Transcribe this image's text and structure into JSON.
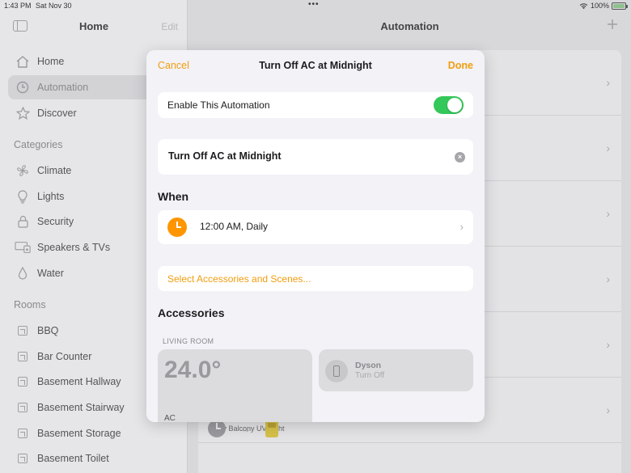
{
  "status_bar": {
    "time": "1:43 PM",
    "date": "Sat Nov 30",
    "dots": "•••",
    "battery": "100%",
    "battery_level": 1.0
  },
  "sidebar": {
    "title": "Home",
    "edit_label": "Edit",
    "nav": [
      {
        "label": "Home",
        "icon": "house-icon"
      },
      {
        "label": "Automation",
        "icon": "clock-icon"
      },
      {
        "label": "Discover",
        "icon": "star-icon"
      }
    ],
    "categories_header": "Categories",
    "categories": [
      {
        "label": "Climate",
        "icon": "fan-icon"
      },
      {
        "label": "Lights",
        "icon": "lightbulb-icon"
      },
      {
        "label": "Security",
        "icon": "lock-icon"
      },
      {
        "label": "Speakers & TVs",
        "icon": "tv-icon"
      },
      {
        "label": "Water",
        "icon": "drop-icon"
      }
    ],
    "rooms_header": "Rooms",
    "rooms": [
      "BBQ",
      "Bar Counter",
      "Basement Hallway",
      "Basement Stairway",
      "Basement Storage",
      "Basement Toilet"
    ]
  },
  "main": {
    "title": "Automation",
    "partial_label": "Study Balcony UV Light"
  },
  "modal": {
    "cancel_label": "Cancel",
    "title": "Turn Off AC at Midnight",
    "done_label": "Done",
    "enable_label": "Enable This Automation",
    "enabled": true,
    "name_value": "Turn Off AC at Midnight",
    "when_header": "When",
    "trigger": "12:00 AM, Daily",
    "select_label": "Select Accessories and Scenes...",
    "accessories_header": "Accessories",
    "room_label": "LIVING ROOM",
    "ac_tile": {
      "value": "24.0°",
      "name": "AC"
    },
    "dyson_tile": {
      "name": "Dyson",
      "state": "Turn Off"
    }
  },
  "colors": {
    "accent": "#f29d0e",
    "toggle_on": "#34c759",
    "clock": "#ff9500"
  }
}
